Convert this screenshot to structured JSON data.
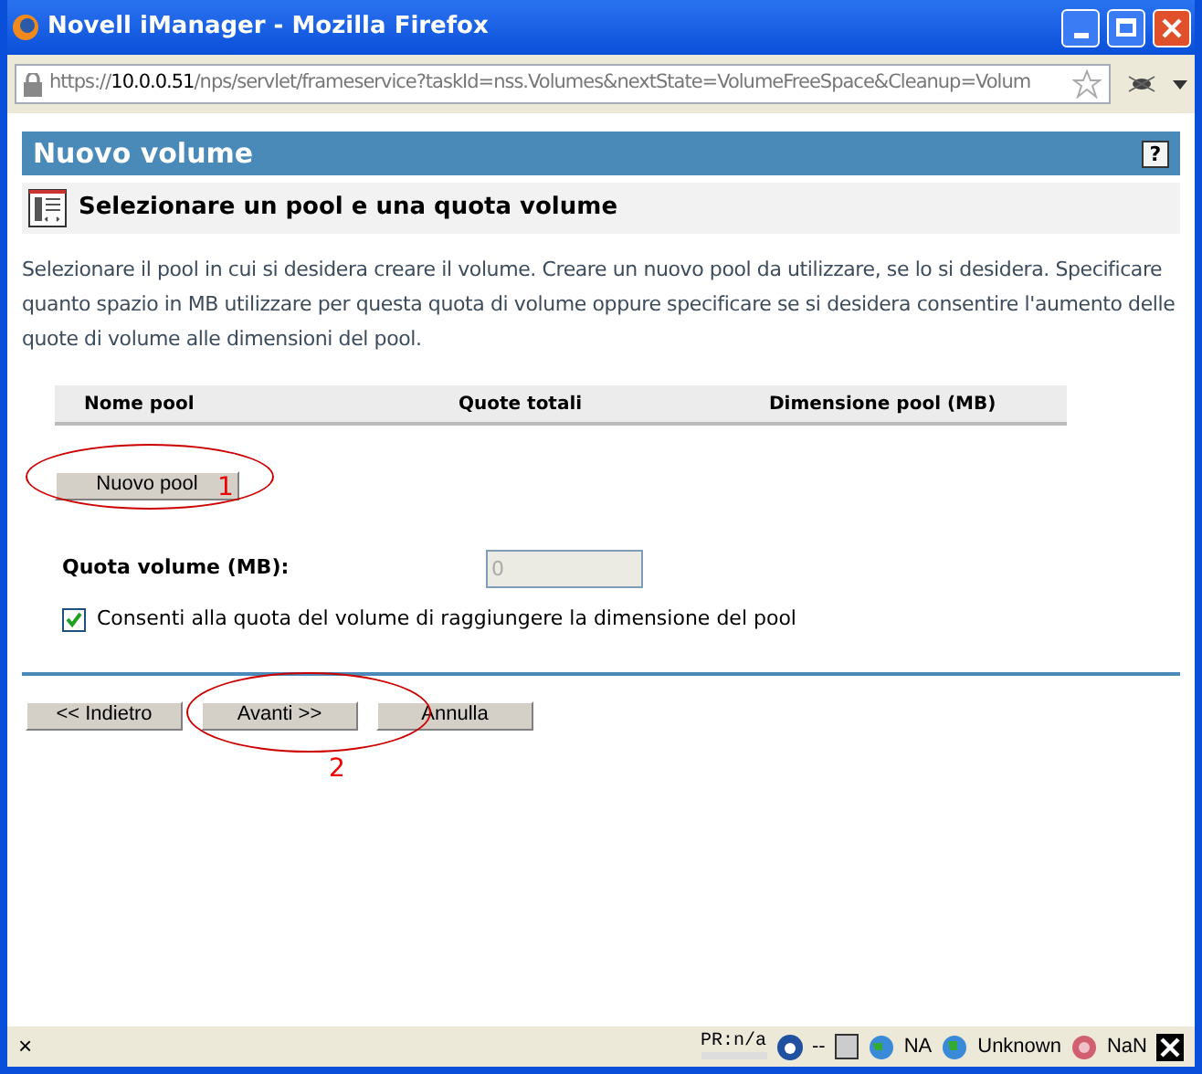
{
  "window": {
    "title": "Novell iManager - Mozilla Firefox"
  },
  "address_bar": {
    "url_prefix": "https://",
    "host": "10.0.0.51",
    "path": "/nps/servlet/frameservice?taskId=nss.Volumes&nextState=VolumeFreeSpace&Cleanup=Volum"
  },
  "header": {
    "title": "Nuovo volume",
    "help": "?"
  },
  "subheader": {
    "title": "Selezionare un pool e una quota volume"
  },
  "description": "Selezionare il pool in cui si desidera creare il volume. Creare un nuovo pool da utilizzare, se lo si desidera. Specificare quanto spazio in MB utilizzare per questa quota di volume oppure specificare se si desidera consentire l'aumento delle quote di volume alle dimensioni del pool.",
  "table": {
    "columns": [
      "Nome pool",
      "Quote totali",
      "Dimensione pool (MB)"
    ]
  },
  "new_pool_button": "Nuovo pool",
  "quota": {
    "label": "Quota volume (MB):",
    "value": "0",
    "disabled": true
  },
  "allow_growth": {
    "label": "Consenti alla quota del volume di raggiungere la dimensione del pool",
    "checked": true
  },
  "buttons": [
    "<< Indietro",
    "Avanti >>",
    "Annulla"
  ],
  "annotations": [
    {
      "label": "1"
    },
    {
      "label": "2"
    }
  ],
  "status_bar": {
    "close": "×",
    "pagerank": "PR:n/a",
    "items": [
      {
        "kind": "text",
        "text": "--"
      },
      {
        "kind": "text",
        "text": "NA"
      },
      {
        "kind": "text",
        "text": "Unknown"
      },
      {
        "kind": "text",
        "text": "NaN"
      }
    ]
  }
}
